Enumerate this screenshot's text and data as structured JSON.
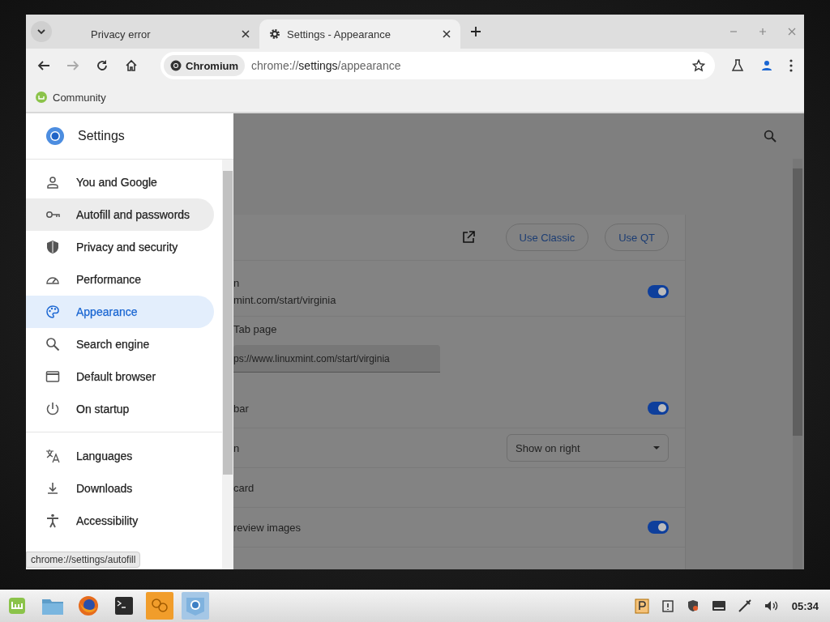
{
  "tabs": [
    {
      "title": "Privacy error",
      "selected": false
    },
    {
      "title": "Settings - Appearance",
      "selected": true
    }
  ],
  "toolbar": {
    "forward_disabled": true,
    "site_chip": "Chromium",
    "url": {
      "scheme": "chrome://",
      "host": "settings",
      "path": "/appearance"
    }
  },
  "bookmarks": [
    {
      "label": "Community"
    }
  ],
  "drawer": {
    "title": "Settings",
    "items": [
      {
        "label": "You and Google",
        "selected": false,
        "hovered": false
      },
      {
        "label": "Autofill and passwords",
        "selected": false,
        "hovered": true
      },
      {
        "label": "Privacy and security",
        "selected": false,
        "hovered": false
      },
      {
        "label": "Performance",
        "selected": false,
        "hovered": false
      },
      {
        "label": "Appearance",
        "selected": true,
        "hovered": false
      },
      {
        "label": "Search engine",
        "selected": false,
        "hovered": false
      },
      {
        "label": "Default browser",
        "selected": false,
        "hovered": false
      },
      {
        "label": "On startup",
        "selected": false,
        "hovered": false
      },
      {
        "kind": "divider"
      },
      {
        "label": "Languages",
        "selected": false,
        "hovered": false
      },
      {
        "label": "Downloads",
        "selected": false,
        "hovered": false
      },
      {
        "label": "Accessibility",
        "selected": false,
        "hovered": false
      }
    ]
  },
  "status_bubble": "chrome://settings/autofill",
  "theme_buttons": [
    "Use Classic",
    "Use QT"
  ],
  "rows": [
    {
      "kind": "toggle",
      "label": "n",
      "sublabel": "mint.com/start/virginia",
      "on": true
    },
    {
      "kind": "field",
      "label": "Tab page",
      "value": "ps://www.linuxmint.com/start/virginia"
    },
    {
      "kind": "toggle",
      "label": "bar",
      "on": true
    },
    {
      "kind": "select",
      "label": "n",
      "value": "Show on right"
    },
    {
      "kind": "plain",
      "label": "card"
    },
    {
      "kind": "toggle",
      "label": "review images",
      "on": true
    }
  ],
  "taskbar": {
    "clock": "05:34"
  }
}
